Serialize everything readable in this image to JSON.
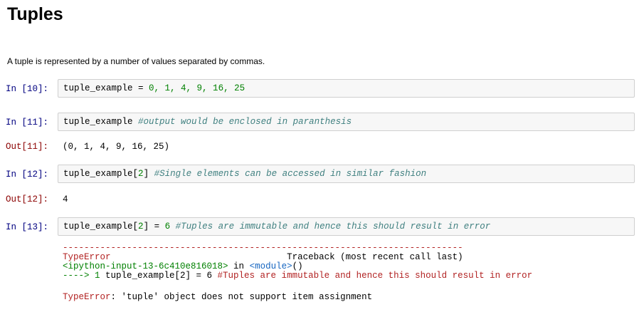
{
  "heading": "Tuples",
  "description": "A tuple is represented by a number of values separated by commas.",
  "cells": [
    {
      "in_prompt": "In [10]:",
      "code_name": "tuple_example",
      "code_eq": " = ",
      "code_values": "0, 1, 4, 9, 16, 25",
      "out_prompt": "",
      "output": ""
    },
    {
      "in_prompt": "In [11]:",
      "code_name": "tuple_example",
      "code_comment": "#output would be enclosed in paranthesis",
      "out_prompt": "Out[11]:",
      "output": "(0, 1, 4, 9, 16, 25)"
    },
    {
      "in_prompt": "In [12]:",
      "code_name": "tuple_example",
      "code_index_open": "[",
      "code_index": "2",
      "code_index_close": "]",
      "code_comment": "#Single elements can be accessed in similar fashion",
      "out_prompt": "Out[12]:",
      "output": "4"
    },
    {
      "in_prompt": "In [13]:",
      "code_name": "tuple_example",
      "code_index_open": "[",
      "code_index": "2",
      "code_index_close": "]",
      "code_eq": " = ",
      "code_value": "6",
      "code_comment": "#Tuples are immutable and hence this should result in error"
    }
  ],
  "traceback": {
    "rule": "---------------------------------------------------------------------------",
    "error_type": "TypeError",
    "header_spacer": "                                 ",
    "header_right": "Traceback (most recent call last)",
    "input_ref": "<ipython-input-13-6c410e816018>",
    "in_word": " in ",
    "module_ref": "<module>",
    "module_suffix": "()",
    "arrow": "----> 1 ",
    "line_code": "tuple_example[2] = 6 ",
    "line_comment": "#Tuples are immutable and hence this should result in error",
    "final_type": "TypeError",
    "final_message": ": 'tuple' object does not support item assignment"
  }
}
